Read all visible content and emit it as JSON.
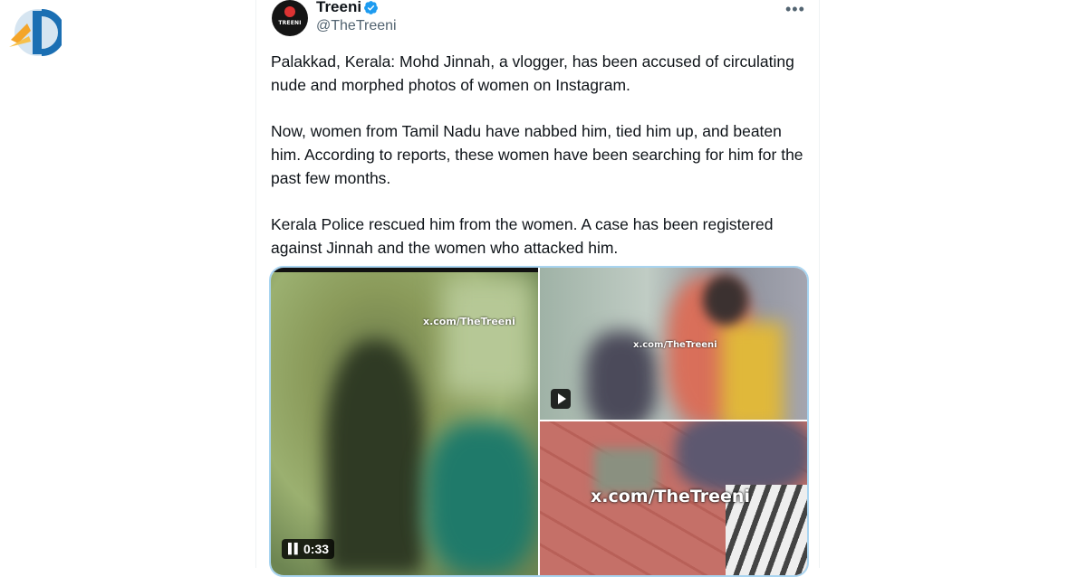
{
  "account": {
    "name": "Treeni",
    "handle": "@TheTreeni",
    "avatar_text": "TREENI",
    "verified_icon": "verified-badge-icon"
  },
  "menu": {
    "more_label": "•••"
  },
  "post": {
    "paragraphs": [
      "Palakkad, Kerala: Mohd Jinnah, a vlogger, has been accused of circulating nude and morphed photos of women on Instagram.",
      "Now, women from Tamil Nadu have nabbed him, tied him up, and beaten him. According to reports, these women have been searching for him for the past few months.",
      "Kerala Police rescued him from the women. A case has been registered against Jinnah and the women who attacked him."
    ]
  },
  "media": {
    "video1": {
      "watermark": "x.com/TheTreeni",
      "time": "0:33",
      "state_icon": "pause-icon"
    },
    "video2": {
      "watermark": "x.com/TheTreeni",
      "state_icon": "play-icon"
    },
    "image3": {
      "watermark": "x.com/TheTreeni"
    }
  },
  "colors": {
    "text": "#0f1419",
    "secondary": "#536471",
    "verified": "#1d9bf0",
    "media_border": "#a8d4f0"
  }
}
